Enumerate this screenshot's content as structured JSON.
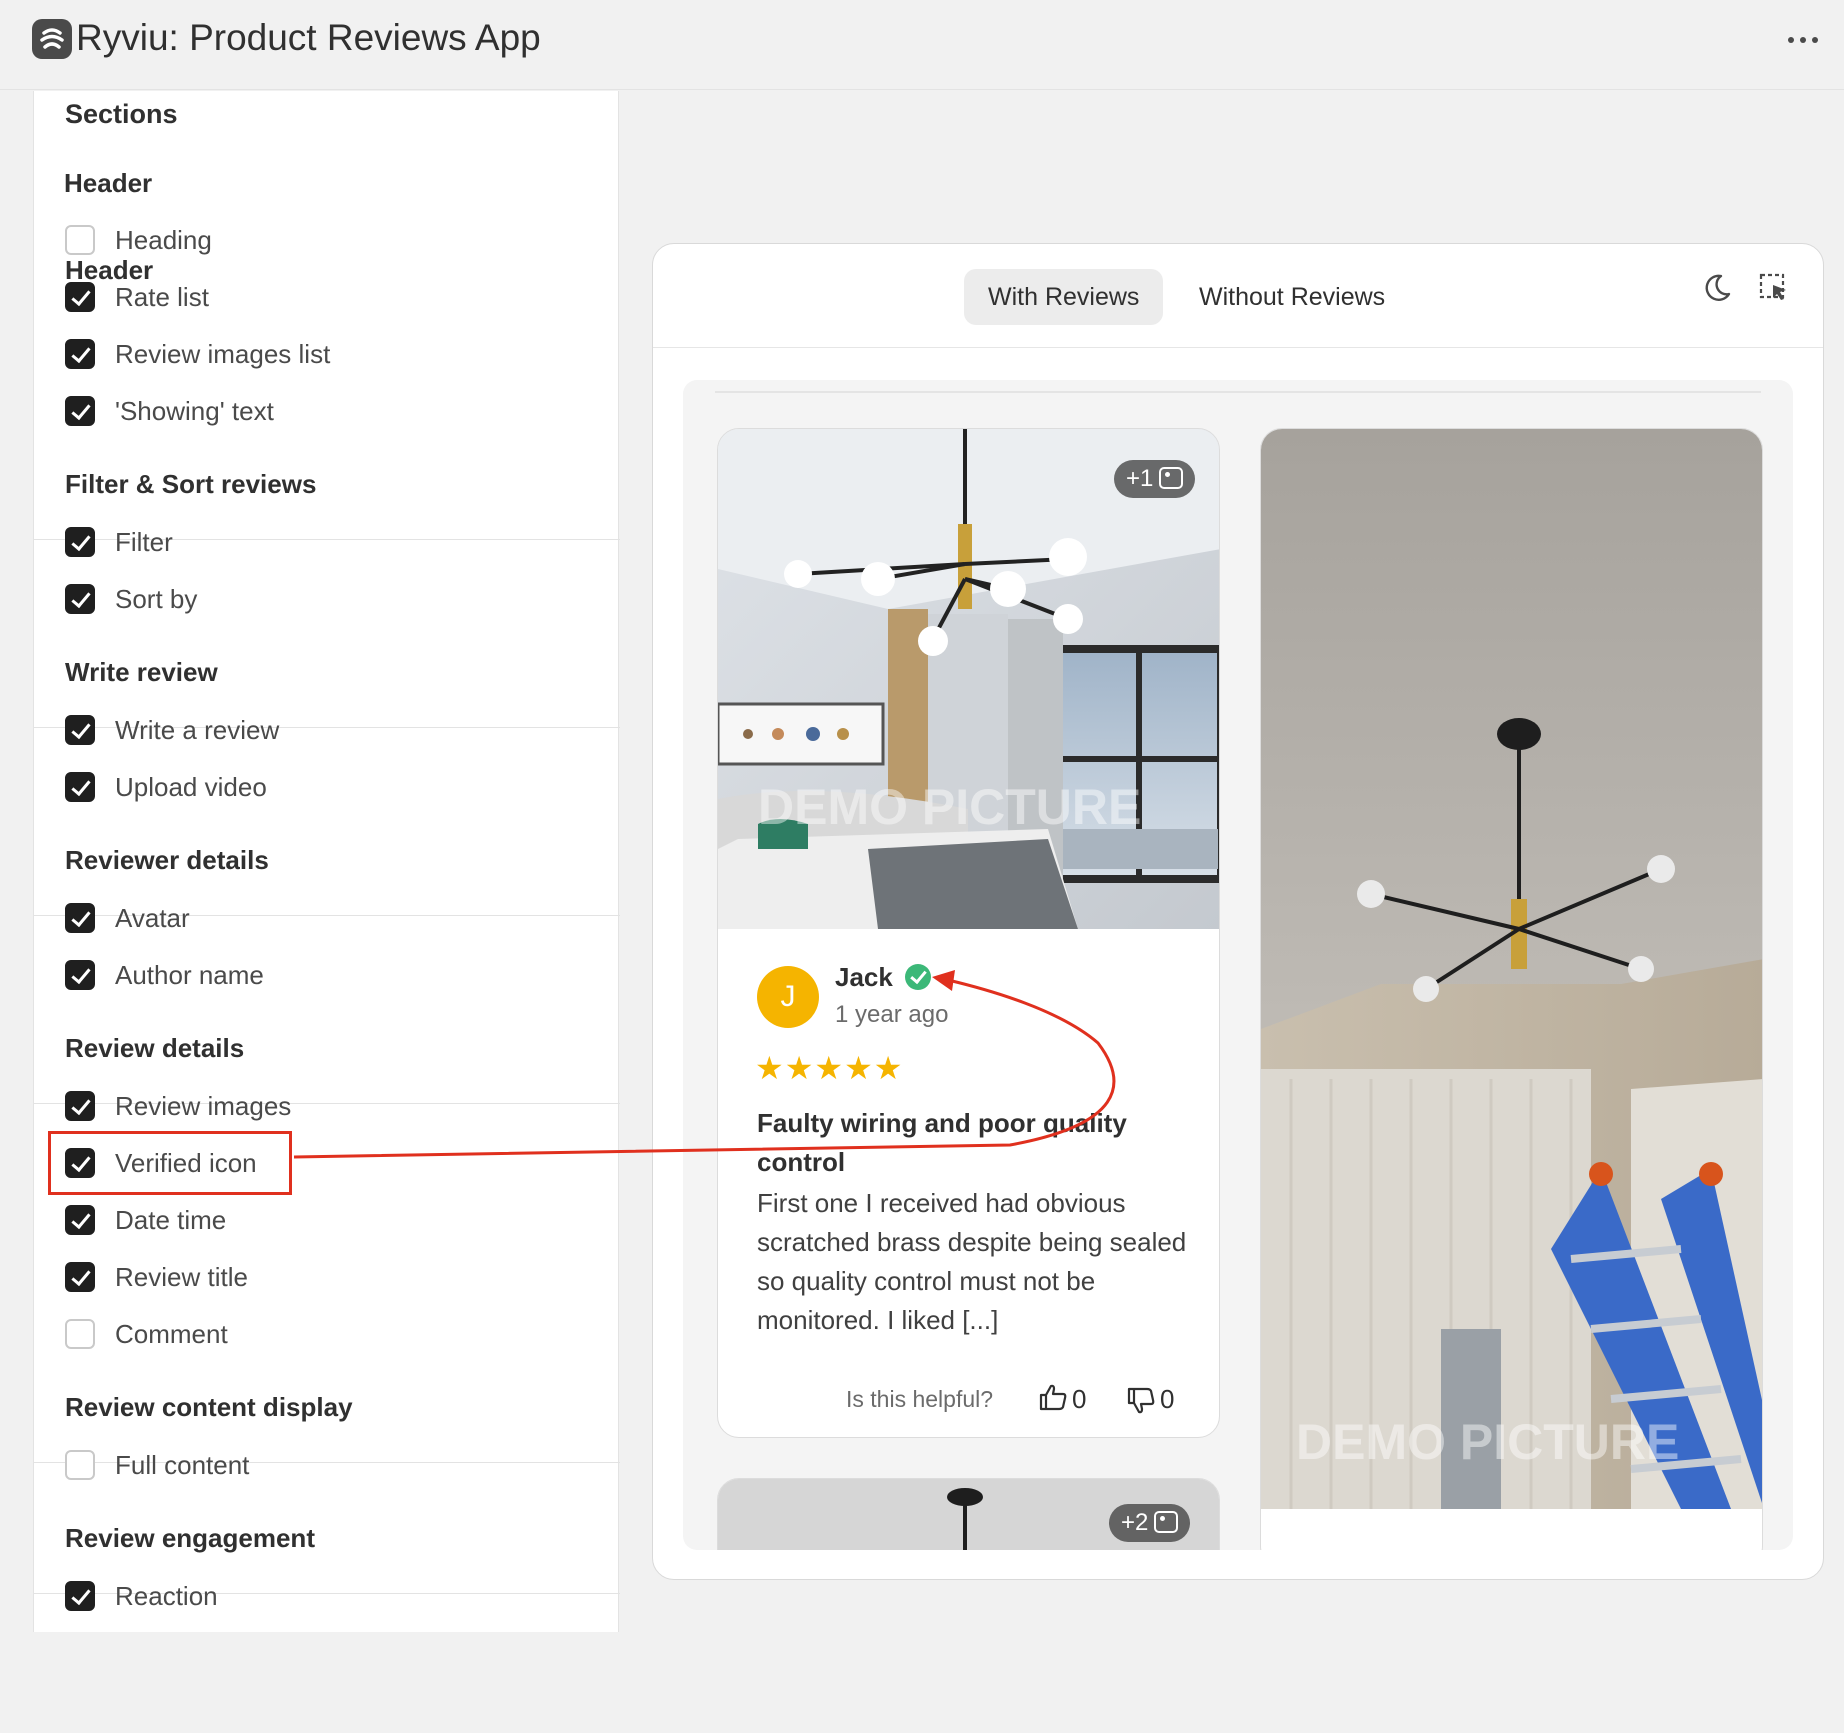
{
  "app": {
    "title": "Ryviu: Product Reviews App",
    "logo_icon": "ryviu-logo-icon",
    "more_icon": "more-horizontal-icon"
  },
  "sidebar": {
    "title": "Sections",
    "groups": [
      {
        "title": "Header",
        "options": [
          {
            "label": "Heading",
            "checked": false
          },
          {
            "label": "Rate list",
            "checked": true
          },
          {
            "label": "Review images list",
            "checked": true
          },
          {
            "label": "'Showing' text",
            "checked": true
          }
        ]
      },
      {
        "title": "Filter & Sort reviews",
        "options": [
          {
            "label": "Filter",
            "checked": true
          },
          {
            "label": "Sort by",
            "checked": true
          }
        ]
      },
      {
        "title": "Write review",
        "options": [
          {
            "label": "Write a review",
            "checked": true
          },
          {
            "label": "Upload video",
            "checked": true
          }
        ]
      },
      {
        "title": "Reviewer details",
        "options": [
          {
            "label": "Avatar",
            "checked": true
          },
          {
            "label": "Author name",
            "checked": true
          }
        ]
      },
      {
        "title": "Review details",
        "options": [
          {
            "label": "Review images",
            "checked": true
          },
          {
            "label": "Verified icon",
            "checked": true
          },
          {
            "label": "Date time",
            "checked": true
          },
          {
            "label": "Review title",
            "checked": true
          },
          {
            "label": "Comment",
            "checked": false
          }
        ]
      },
      {
        "title": "Review content display",
        "options": [
          {
            "label": "Full content",
            "checked": false
          }
        ]
      },
      {
        "title": "Review engagement",
        "options": [
          {
            "label": "Reaction",
            "checked": true
          }
        ]
      }
    ]
  },
  "preview": {
    "tabs": [
      {
        "label": "With Reviews",
        "active": true
      },
      {
        "label": "Without Reviews",
        "active": false
      }
    ],
    "icons": {
      "theme": "moon-icon",
      "select": "cursor-select-icon"
    },
    "cards": [
      {
        "image_badge": "+1",
        "watermark": "DEMO PICTURE",
        "avatar_initial": "J",
        "author": "Jack",
        "date": "1 year ago",
        "rating": 5,
        "stars": "★★★★★",
        "title": "Faulty wiring and poor quality control",
        "body": "First one I received had obvious scratched brass despite being sealed so quality control must not be monitored. I liked [...]",
        "helpful_label": "Is this helpful?",
        "likes": "0",
        "dislikes": "0"
      },
      {
        "watermark": "DEMO PICTURE"
      },
      {
        "image_badge": "+2"
      }
    ]
  },
  "colors": {
    "accent_checkbox": "#1f1f1f",
    "annotation": "#e0301e",
    "star": "#f5b400",
    "verified": "#3cb878",
    "avatar": "#f5b400"
  }
}
